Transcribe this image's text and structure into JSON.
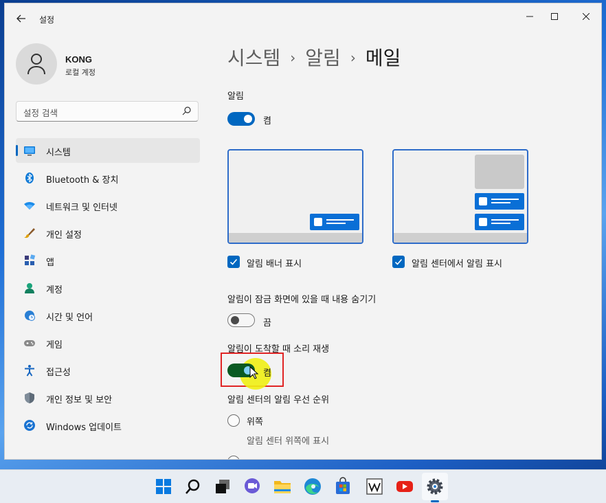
{
  "window": {
    "title": "설정"
  },
  "user": {
    "name": "KONG",
    "account_type": "로컬 계정"
  },
  "search": {
    "placeholder": "설정 검색"
  },
  "sidebar": {
    "items": [
      {
        "label": "시스템",
        "icon": "system-monitor-icon",
        "selected": true
      },
      {
        "label": "Bluetooth & 장치",
        "icon": "bluetooth-icon",
        "selected": false
      },
      {
        "label": "네트워크 및 인터넷",
        "icon": "wifi-icon",
        "selected": false
      },
      {
        "label": "개인 설정",
        "icon": "brush-icon",
        "selected": false
      },
      {
        "label": "앱",
        "icon": "apps-icon",
        "selected": false
      },
      {
        "label": "계정",
        "icon": "person-icon",
        "selected": false
      },
      {
        "label": "시간 및 언어",
        "icon": "globe-clock-icon",
        "selected": false
      },
      {
        "label": "게임",
        "icon": "gamepad-icon",
        "selected": false
      },
      {
        "label": "접근성",
        "icon": "accessibility-icon",
        "selected": false
      },
      {
        "label": "개인 정보 및 보안",
        "icon": "shield-icon",
        "selected": false
      },
      {
        "label": "Windows 업데이트",
        "icon": "update-icon",
        "selected": false
      }
    ]
  },
  "breadcrumb": {
    "level1": "시스템",
    "level2": "알림",
    "current": "메일",
    "separator": "›"
  },
  "main": {
    "notifications": {
      "label": "알림",
      "state": "켬",
      "on": true
    },
    "show_banner": {
      "label": "알림 배너 표시",
      "checked": true
    },
    "show_in_center": {
      "label": "알림 센터에서 알림 표시",
      "checked": true
    },
    "hide_on_lock": {
      "label": "알림이 잠금 화면에 있을 때 내용 숨기기",
      "state": "끔",
      "on": false
    },
    "play_sound": {
      "label": "알림이 도착할 때 소리 재생",
      "state": "켬",
      "on": true
    },
    "priority": {
      "label": "알림 센터의 알림 우선 순위",
      "option_top": "위쪽",
      "option_top_desc": "알림 센터 위쪽에 표시"
    }
  },
  "taskbar": {
    "apps": [
      "start-icon",
      "search-icon",
      "task-view-icon",
      "chat-icon",
      "file-explorer-icon",
      "edge-icon",
      "store-icon",
      "wikipedia-icon",
      "youtube-icon",
      "settings-icon"
    ],
    "active_app": "settings-icon"
  },
  "colors": {
    "accent": "#0067c0",
    "highlight": "#e02424"
  }
}
